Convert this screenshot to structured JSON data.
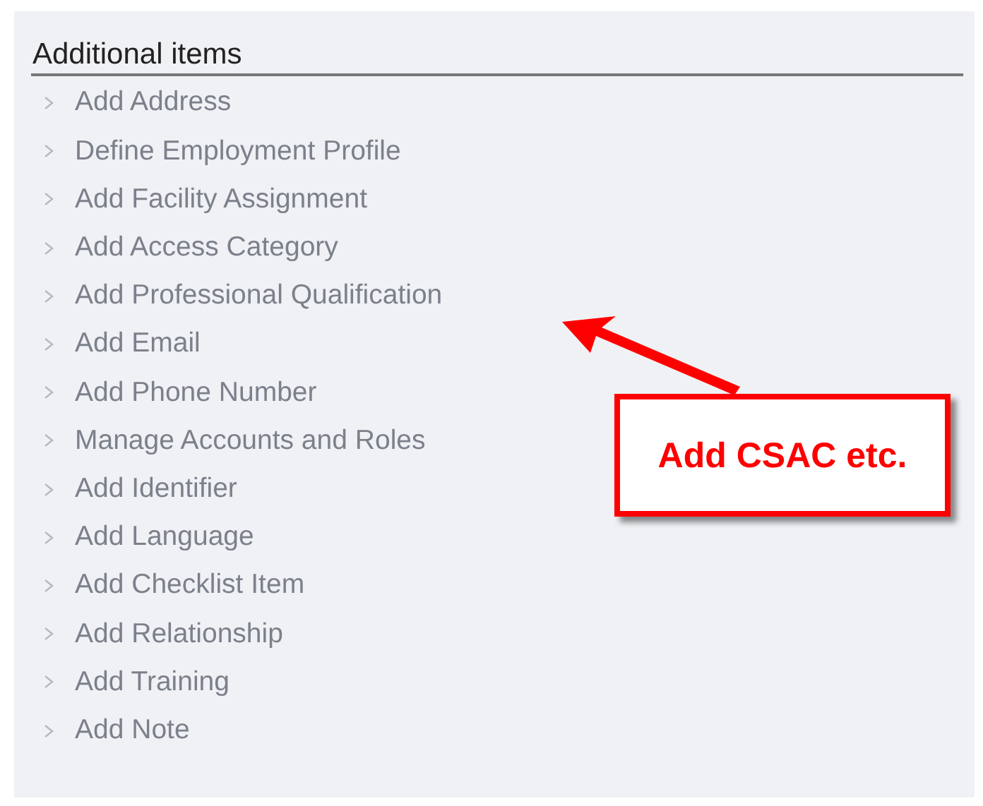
{
  "panel": {
    "title": "Additional items"
  },
  "items": [
    {
      "label": "Add Address"
    },
    {
      "label": "Define Employment Profile"
    },
    {
      "label": "Add Facility Assignment"
    },
    {
      "label": "Add Access Category"
    },
    {
      "label": "Add Professional Qualification"
    },
    {
      "label": "Add Email"
    },
    {
      "label": "Add Phone Number"
    },
    {
      "label": "Manage Accounts and Roles"
    },
    {
      "label": "Add Identifier"
    },
    {
      "label": "Add Language"
    },
    {
      "label": "Add Checklist Item"
    },
    {
      "label": "Add Relationship"
    },
    {
      "label": "Add Training"
    },
    {
      "label": "Add Note"
    }
  ],
  "callout": {
    "text": "Add CSAC etc."
  }
}
